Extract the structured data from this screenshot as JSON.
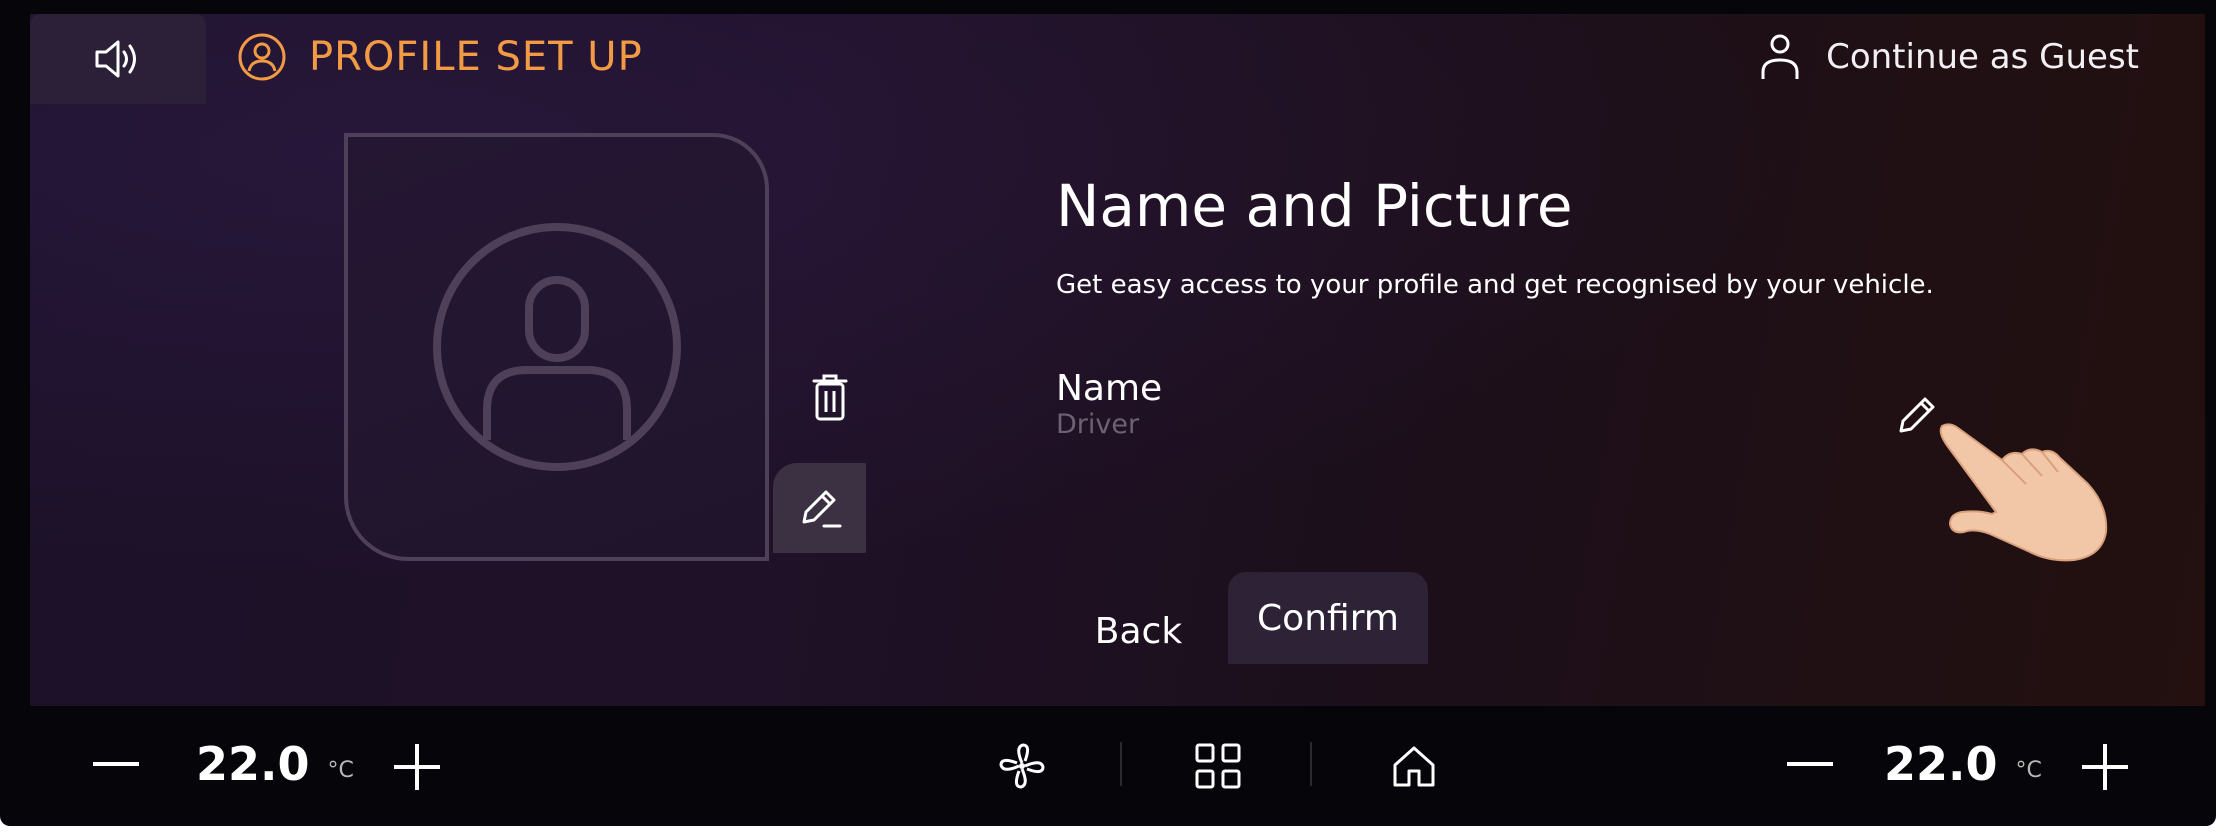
{
  "header": {
    "title": "PROFILE SET UP",
    "guest_label": "Continue as Guest",
    "sound_icon": "speaker-icon",
    "profile_icon": "profile-circle-icon",
    "guest_icon": "person-icon"
  },
  "main": {
    "heading": "Name and Picture",
    "subtitle": "Get easy access to your profile and get recognised by your vehicle.",
    "name_label": "Name",
    "name_value": "Driver",
    "back_label": "Back",
    "confirm_label": "Confirm"
  },
  "climate": {
    "left": {
      "minus": "—",
      "temp": "22.0",
      "unit": "°C",
      "plus": "+"
    },
    "right": {
      "minus": "—",
      "temp": "22.0",
      "unit": "°C",
      "plus": "+"
    },
    "center_icons": [
      "fan-icon",
      "apps-grid-icon",
      "home-icon"
    ]
  },
  "colors": {
    "accent": "#f39a44",
    "background": "#1d1126",
    "button": "#2d2236",
    "muted_text": "#6b6272"
  }
}
